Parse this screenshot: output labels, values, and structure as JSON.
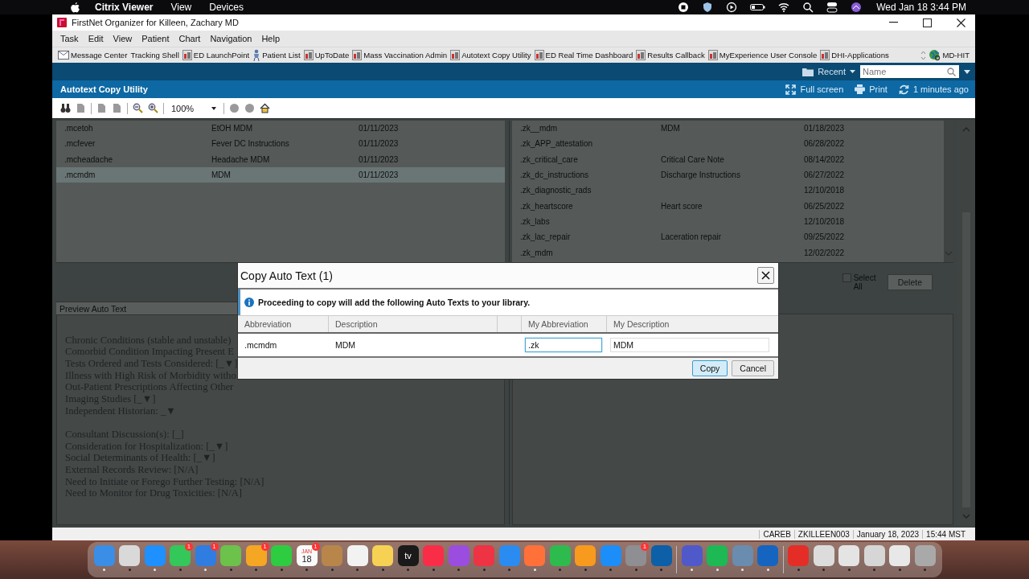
{
  "mac_menubar": {
    "app_name": "Citrix Viewer",
    "menus": [
      "View",
      "Devices"
    ],
    "clock": "Wed Jan 18  3:44 PM"
  },
  "window": {
    "title": "FirstNet Organizer for Killeen, Zachary MD"
  },
  "menu_bar": [
    "Task",
    "Edit",
    "View",
    "Patient",
    "Chart",
    "Navigation",
    "Help"
  ],
  "toolbar_links": [
    {
      "label": "Message Center",
      "kind": "envelope"
    },
    {
      "label": "Tracking Shell",
      "kind": "none"
    },
    {
      "label": "ED LaunchPoint",
      "kind": "app"
    },
    {
      "label": "Patient List",
      "kind": "person"
    },
    {
      "label": "UpToDate",
      "kind": "app"
    },
    {
      "label": "Mass Vaccination Admin",
      "kind": "app"
    },
    {
      "label": "Autotext Copy Utility",
      "kind": "app"
    },
    {
      "label": "ED Real Time Dashboard",
      "kind": "app"
    },
    {
      "label": "Results Callback",
      "kind": "app"
    },
    {
      "label": "MyExperience User Console",
      "kind": "app"
    },
    {
      "label": "DHI-Applications",
      "kind": "app"
    },
    {
      "label": "MD-HIT",
      "kind": "globe"
    }
  ],
  "search_bar": {
    "recent": "Recent",
    "placeholder": "Name"
  },
  "page_header": {
    "title": "Autotext Copy Utility",
    "actions": [
      {
        "label": "Full screen",
        "kind": "expand"
      },
      {
        "label": "Print",
        "kind": "print"
      },
      {
        "label": "1 minutes ago",
        "kind": "refresh"
      }
    ]
  },
  "page_toolbar": {
    "zoom": "100%"
  },
  "left_list": {
    "rows": [
      {
        "abbreviation": ".mcetoh",
        "description": "EtOH MDM",
        "date": "01/11/2023",
        "selected": false
      },
      {
        "abbreviation": ".mcfever",
        "description": "Fever DC Instructions",
        "date": "01/11/2023",
        "selected": false
      },
      {
        "abbreviation": ".mcheadache",
        "description": "Headache MDM",
        "date": "01/11/2023",
        "selected": false
      },
      {
        "abbreviation": ".mcmdm",
        "description": "MDM",
        "date": "01/11/2023",
        "selected": true
      }
    ]
  },
  "right_list": {
    "rows": [
      {
        "abbreviation": ".zk__mdm",
        "description": "MDM",
        "date": "01/18/2023"
      },
      {
        "abbreviation": ".zk_APP_attestation",
        "date": "06/28/2022"
      },
      {
        "abbreviation": ".zk_critical_care",
        "description": "Critical Care Note",
        "date": "08/14/2022"
      },
      {
        "abbreviation": ".zk_dc_instructions",
        "description": "Discharge Instructions",
        "date": "06/27/2022"
      },
      {
        "abbreviation": ".zk_diagnostic_rads",
        "date": "12/10/2018"
      },
      {
        "abbreviation": ".zk_heartscore",
        "description": "Heart score",
        "date": "06/25/2022"
      },
      {
        "abbreviation": ".zk_labs",
        "date": "12/10/2018"
      },
      {
        "abbreviation": ".zk_lac_repair",
        "description": "Laceration repair",
        "date": "09/25/2022"
      },
      {
        "abbreviation": ".zk_mdm",
        "date": "12/02/2022"
      }
    ]
  },
  "select_all": {
    "label": "Select All",
    "checked": false
  },
  "delete_button": {
    "label": "Delete",
    "disabled": true
  },
  "preview": {
    "title": "Preview Auto Text",
    "paragraphs": [
      [
        "Chronic Conditions (stable and unstable)",
        "Comorbid Condition Impacting Present E",
        "Tests Ordered and Tests Considered: [_▼]",
        "Illness with High Risk of Morbidity witho",
        "Out-Patient Prescriptions Affecting Other",
        "Imaging Studies [_▼]",
        "Independent Historian: _▼"
      ],
      [
        "Consultant Discussion(s): [_]",
        "Consideration for Hospitalization: [_▼]",
        "Social Determinants of Health: [_▼]",
        "External Records Review: [N/A]",
        "Need to Initiate or Forego Further Testing: [N/A]",
        "Need to Monitor for Drug Toxicities: [N/A]"
      ]
    ]
  },
  "dialog": {
    "title": "Copy Auto Text (1)",
    "message": "Proceeding to copy will add the following Auto Texts to your library.",
    "columns": [
      "Abbreviation",
      "Description",
      "My Abbreviation",
      "My Description"
    ],
    "row": {
      "abbreviation": ".mcmdm",
      "description": "MDM",
      "my_abbreviation": ".zk",
      "my_description": "MDM"
    },
    "buttons": [
      "Copy",
      "Cancel"
    ]
  },
  "status_bar": [
    "CAREB",
    "ZKILLEEN003",
    "January 18, 2023",
    "15:44 MST"
  ],
  "dock": {
    "apps": [
      {
        "color": "#3a8ee6",
        "running": true
      },
      {
        "color": "#d9d9d9",
        "running": false
      },
      {
        "color": "#1e90ff",
        "running": true
      },
      {
        "color": "#34c759",
        "running": false,
        "badge": "1"
      },
      {
        "color": "#2f7de1",
        "running": true,
        "badge": "1"
      },
      {
        "color": "#6cc24a",
        "running": false
      },
      {
        "color": "#f5a623",
        "running": false,
        "badge": "1"
      },
      {
        "color": "#2ecc40",
        "running": false
      },
      {
        "color": "#fafafa",
        "running": false,
        "badge": "1",
        "caption": "JAN",
        "text": "18"
      },
      {
        "color": "#b8864b",
        "running": false
      },
      {
        "color": "#f2f2f2",
        "running": false
      },
      {
        "color": "#f7d154",
        "running": false
      },
      {
        "color": "#1a1a1a",
        "running": false,
        "text": "tv"
      },
      {
        "color": "#fa2d48",
        "running": false
      },
      {
        "color": "#9b4de0",
        "running": false
      },
      {
        "color": "#ee3344",
        "running": false
      },
      {
        "color": "#2a8cf0",
        "running": false
      },
      {
        "color": "#ff7139",
        "running": true
      },
      {
        "color": "#2dbb4e",
        "running": false
      },
      {
        "color": "#f79a1e",
        "running": false
      },
      {
        "color": "#1c8ef9",
        "running": false
      },
      {
        "color": "#8e8e93",
        "running": false,
        "badge": "1"
      },
      {
        "color": "#0d5fa8",
        "running": false
      },
      {
        "color": "#5059c9",
        "running": true
      },
      {
        "color": "#1db954",
        "running": true
      },
      {
        "color": "#6a8caf",
        "running": true
      },
      {
        "color": "#1565c0",
        "running": true
      },
      {
        "color": "#e52d27",
        "running": false
      },
      {
        "color": "#dcdcdc",
        "running": false
      },
      {
        "color": "#e4e4e4",
        "running": false
      },
      {
        "color": "#d6d6d6",
        "running": false
      },
      {
        "color": "#e8e8e8",
        "running": false
      },
      {
        "color": "#a9a9a9",
        "running": false
      }
    ]
  }
}
